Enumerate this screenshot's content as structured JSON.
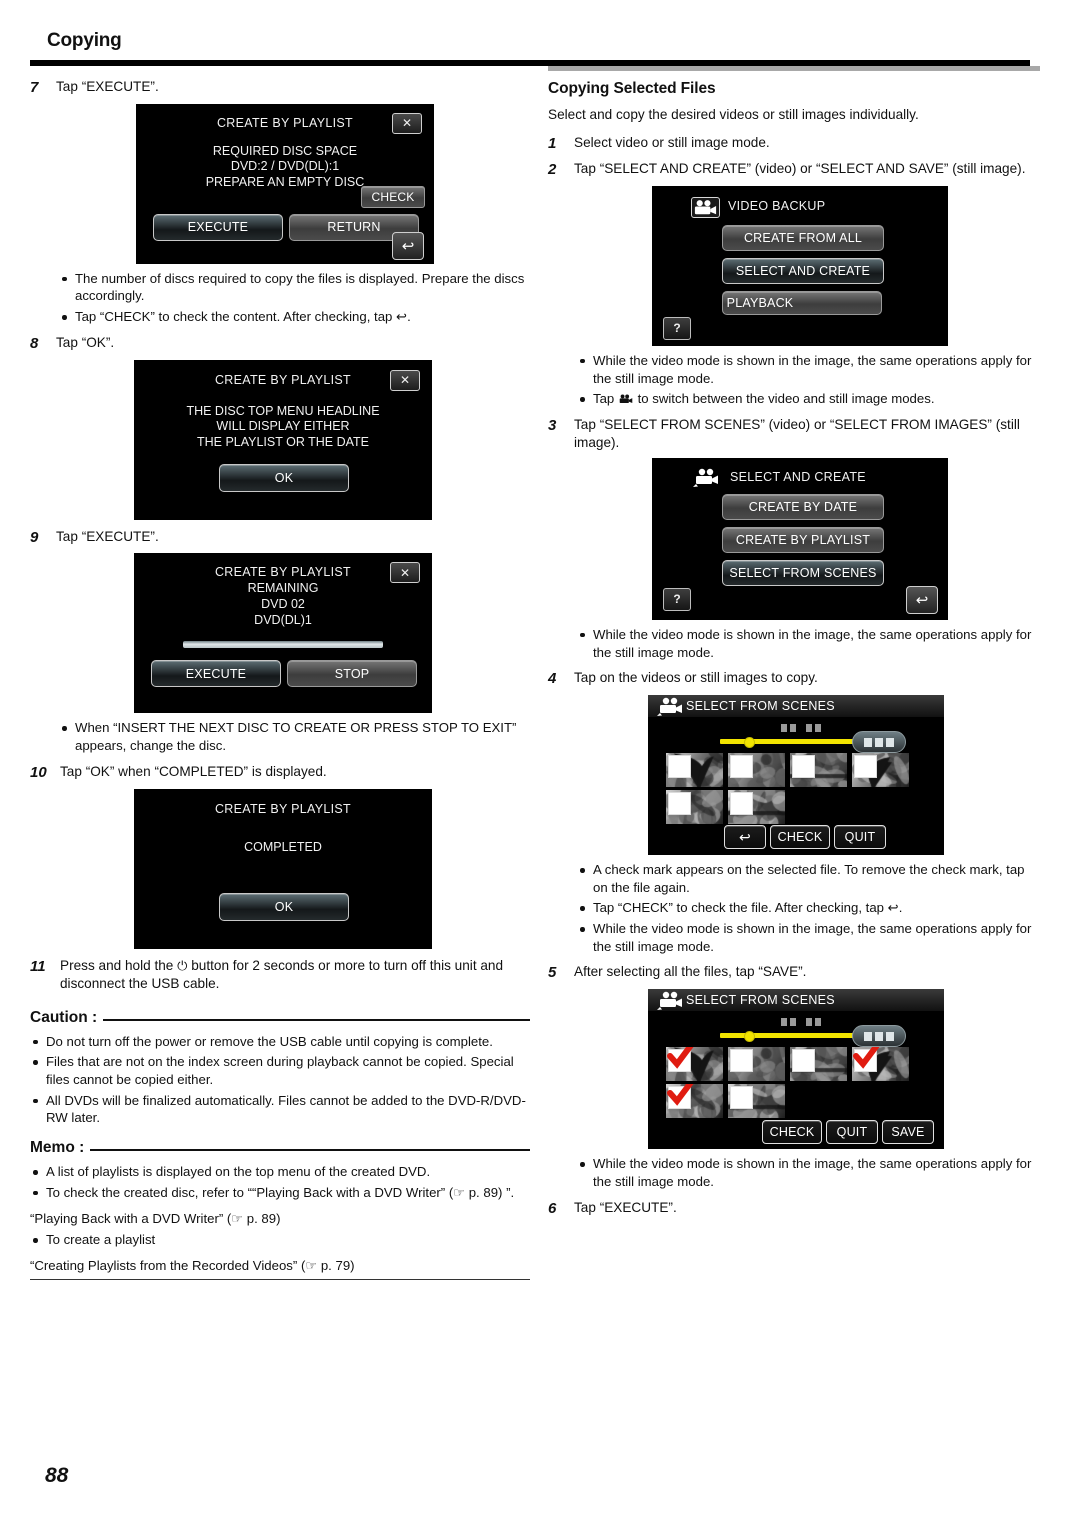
{
  "header": {
    "title": "Copying",
    "page_number": "88"
  },
  "left": {
    "steps": {
      "s7": {
        "num": "7",
        "text": "Tap “EXECUTE”."
      },
      "s8": {
        "num": "8",
        "text": "Tap “OK”."
      },
      "s9": {
        "num": "9",
        "text": "Tap “EXECUTE”."
      },
      "s10": {
        "num": "10",
        "text": "Tap “OK” when “COMPLETED” is displayed."
      },
      "s11": {
        "num": "11",
        "text_a": "Press and hold the ",
        "text_b": " button for 2 seconds or more to turn off this unit and disconnect the USB cable."
      }
    },
    "bullets_after_7": [
      "The number of discs required to copy the files is displayed. Prepare the discs accordingly.",
      "Tap “CHECK” to check the content. After checking, tap ↩."
    ],
    "bullets_after_9": [
      "When “INSERT THE NEXT DISC TO CREATE OR PRESS STOP TO EXIT” appears, change the disc."
    ],
    "caution": {
      "label": "Caution :",
      "items": [
        "Do not turn off the power or remove the USB cable until copying is complete.",
        "Files that are not on the index screen during playback cannot be copied. Special files cannot be copied either.",
        "All DVDs will be finalized automatically. Files cannot be added to the DVD-R/DVD-RW later."
      ]
    },
    "memo": {
      "label": "Memo :",
      "items": [
        "A list of playlists is displayed on the top menu of the created DVD.",
        "To check the created disc, refer to ““Playing Back with a DVD Writer” (☞ p. 89) ”."
      ],
      "link1": "“Playing Back with a DVD Writer” (☞ p. 89)",
      "item2": "To create a playlist",
      "link2": "“Creating Playlists from the Recorded Videos” (☞ p. 79)"
    },
    "screens": {
      "disc_space": {
        "title": "CREATE BY PLAYLIST",
        "body_line1": "REQUIRED DISC SPACE",
        "body_line2": "DVD:2 / DVD(DL):1",
        "body_line3": "PREPARE AN EMPTY DISC",
        "check_label": "CHECK",
        "execute_label": "EXECUTE",
        "return_label": "RETURN",
        "close_label": "✕",
        "back_label": "↩"
      },
      "top_menu": {
        "title": "CREATE BY PLAYLIST",
        "body_line1": "THE DISC TOP MENU HEADLINE",
        "body_line2": "WILL DISPLAY EITHER",
        "body_line3": "THE PLAYLIST OR THE DATE",
        "ok_label": "OK",
        "close_label": "✕"
      },
      "remaining": {
        "title": "CREATE BY PLAYLIST",
        "body_line1": "REMAINING",
        "body_line2": "DVD   02",
        "body_line3": "DVD(DL)1",
        "execute_label": "EXECUTE",
        "stop_label": "STOP",
        "close_label": "✕"
      },
      "completed": {
        "title": "CREATE BY PLAYLIST",
        "body_line1": "COMPLETED",
        "ok_label": "OK"
      }
    }
  },
  "right": {
    "section_title": "Copying Selected Files",
    "lead": "Select and copy the desired videos or still images individually.",
    "steps": {
      "s1": {
        "num": "1",
        "text": "Select video or still image mode."
      },
      "s2": {
        "num": "2",
        "text": "Tap “SELECT AND CREATE” (video) or “SELECT AND SAVE” (still image)."
      },
      "s3": {
        "num": "3",
        "text": "Tap “SELECT FROM SCENES” (video) or “SELECT FROM IMAGES” (still image)."
      },
      "s4": {
        "num": "4",
        "text": "Tap on the videos or still images to copy."
      },
      "s5": {
        "num": "5",
        "text": "After selecting all the files, tap “SAVE”."
      },
      "s6": {
        "num": "6",
        "text": "Tap “EXECUTE”."
      }
    },
    "bullets_after_2a": "While the video mode is shown in the image, the same operations apply for the still image mode.",
    "bullets_after_2b_pre": "Tap ",
    "bullets_after_2b_post": " to switch between the video and still image modes.",
    "bullets_after_3": "While the video mode is shown in the image, the same operations apply for the still image mode.",
    "bullets_after_4": [
      "A check mark appears on the selected file. To remove the check mark, tap on the file again.",
      "Tap “CHECK” to check the file. After checking, tap ↩.",
      "While the video mode is shown in the image, the same operations apply for the still image mode."
    ],
    "bullets_after_5": "While the video mode is shown in the image, the same operations apply for the still image mode.",
    "screens": {
      "video_backup": {
        "title": "VIDEO BACKUP",
        "buttons": [
          "CREATE FROM ALL",
          "SELECT AND CREATE",
          "PLAYBACK"
        ],
        "selected_index": 1,
        "help_label": "?"
      },
      "select_and_create": {
        "title": "SELECT AND CREATE",
        "buttons": [
          "CREATE BY DATE",
          "CREATE BY PLAYLIST",
          "SELECT FROM SCENES"
        ],
        "selected_index": 2,
        "help_label": "?",
        "back_label": "↩"
      },
      "scenes_unchecked": {
        "title": "SELECT FROM SCENES",
        "checked": [
          false,
          false,
          false,
          false,
          false,
          false
        ],
        "back_label": "↩",
        "buttons": [
          "CHECK",
          "QUIT"
        ]
      },
      "scenes_checked": {
        "title": "SELECT FROM SCENES",
        "checked": [
          true,
          false,
          false,
          true,
          true,
          false
        ],
        "buttons": [
          "CHECK",
          "QUIT",
          "SAVE"
        ]
      }
    }
  },
  "colors": {
    "rule_black": "#000000",
    "rule_gray": "#a8a8a8",
    "lcd_bg": "#000000",
    "slider_yellow": "#f2e400",
    "check_red": "#e01b10"
  }
}
